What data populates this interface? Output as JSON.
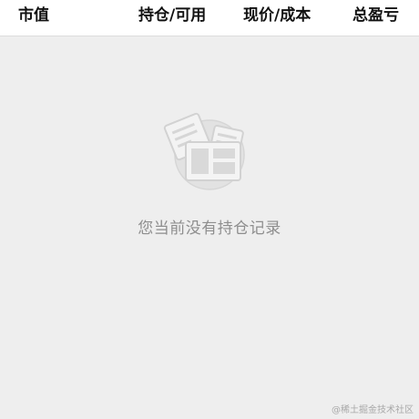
{
  "header": {
    "columns": [
      "市值",
      "持仓/可用",
      "现价/成本",
      "总盈亏"
    ]
  },
  "empty_state": {
    "icon": "document-stack-icon",
    "message": "您当前没有持仓记录"
  },
  "watermark": {
    "text": "@稀土掘金技术社区"
  },
  "colors": {
    "background": "#eeeeee",
    "header_background": "#ffffff",
    "header_text": "#111111",
    "empty_text": "#8e8e8e",
    "icon_gray": "#d6d6d6"
  }
}
